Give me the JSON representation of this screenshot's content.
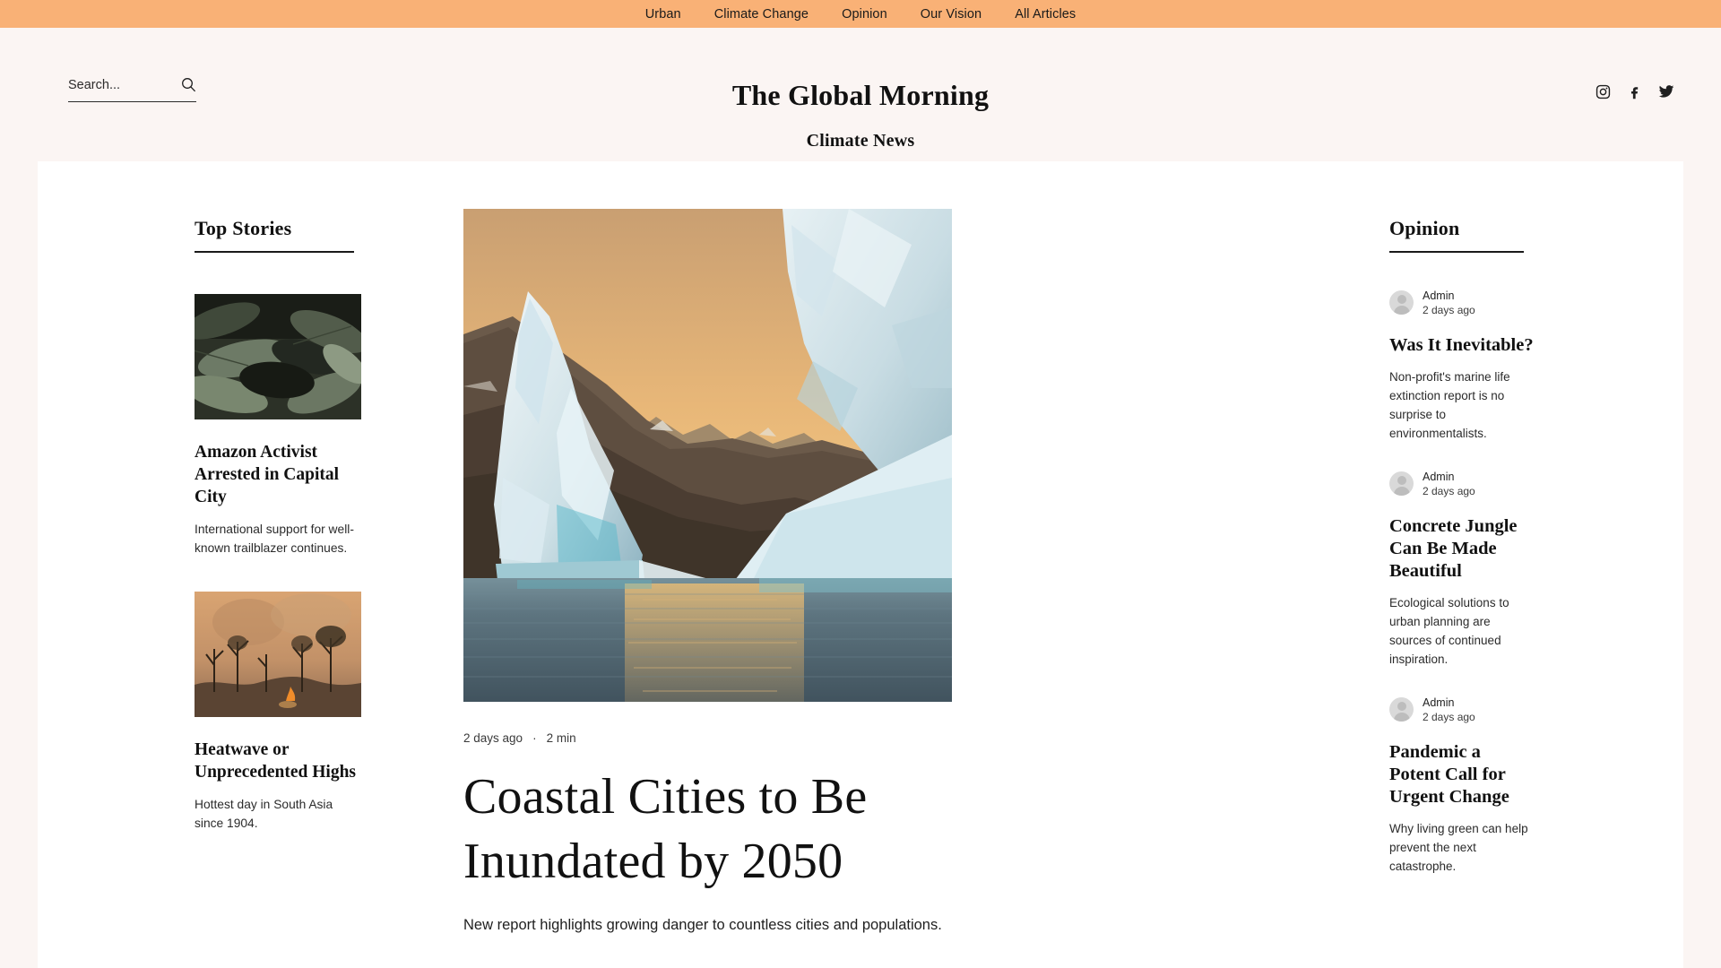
{
  "nav": {
    "items": [
      {
        "label": "Urban"
      },
      {
        "label": "Climate Change"
      },
      {
        "label": "Opinion"
      },
      {
        "label": "Our Vision"
      },
      {
        "label": "All Articles"
      }
    ],
    "bg_color": "#F9B176"
  },
  "search": {
    "placeholder": "Search...",
    "value": "",
    "icon": "search-icon"
  },
  "brand": {
    "title": "The Global Morning",
    "subtitle": "Climate News"
  },
  "social": [
    {
      "name": "instagram-icon",
      "label": "Instagram"
    },
    {
      "name": "facebook-icon",
      "label": "Facebook"
    },
    {
      "name": "twitter-icon",
      "label": "Twitter"
    }
  ],
  "top_stories": {
    "heading": "Top Stories",
    "items": [
      {
        "image_alt": "dark tropical leaves",
        "title": "Amazon Activist Arrested in Capital City",
        "desc": "International support for well-known trailblazer continues."
      },
      {
        "image_alt": "forest fire with smoke and burnt trees",
        "title": "Heatwave or Unprecedented Highs",
        "desc": "Hottest day in South Asia since 1904."
      }
    ]
  },
  "feature": {
    "image_alt": "icebergs on water at sunset",
    "date": "2 days ago",
    "separator": "·",
    "read_time": "2 min",
    "title": "Coastal Cities to Be Inundated by 2050",
    "desc": "New report highlights growing danger to countless cities and populations."
  },
  "opinion": {
    "heading": "Opinion",
    "items": [
      {
        "author": "Admin",
        "date": "2 days ago",
        "title": "Was It Inevitable?",
        "desc": "Non-profit's marine life extinction report is no surprise to environmentalists."
      },
      {
        "author": "Admin",
        "date": "2 days ago",
        "title": "Concrete Jungle Can Be Made Beautiful",
        "desc": "Ecological solutions to urban planning are sources of continued inspiration."
      },
      {
        "author": "Admin",
        "date": "2 days ago",
        "title": "Pandemic a Potent Call for Urgent Change",
        "desc": "Why living green can help prevent the next catastrophe."
      }
    ]
  },
  "theme": {
    "page_bg": "#FBF5F3",
    "content_bg": "#FFFFFF",
    "accent": "#F9B176",
    "text": "#111111"
  }
}
